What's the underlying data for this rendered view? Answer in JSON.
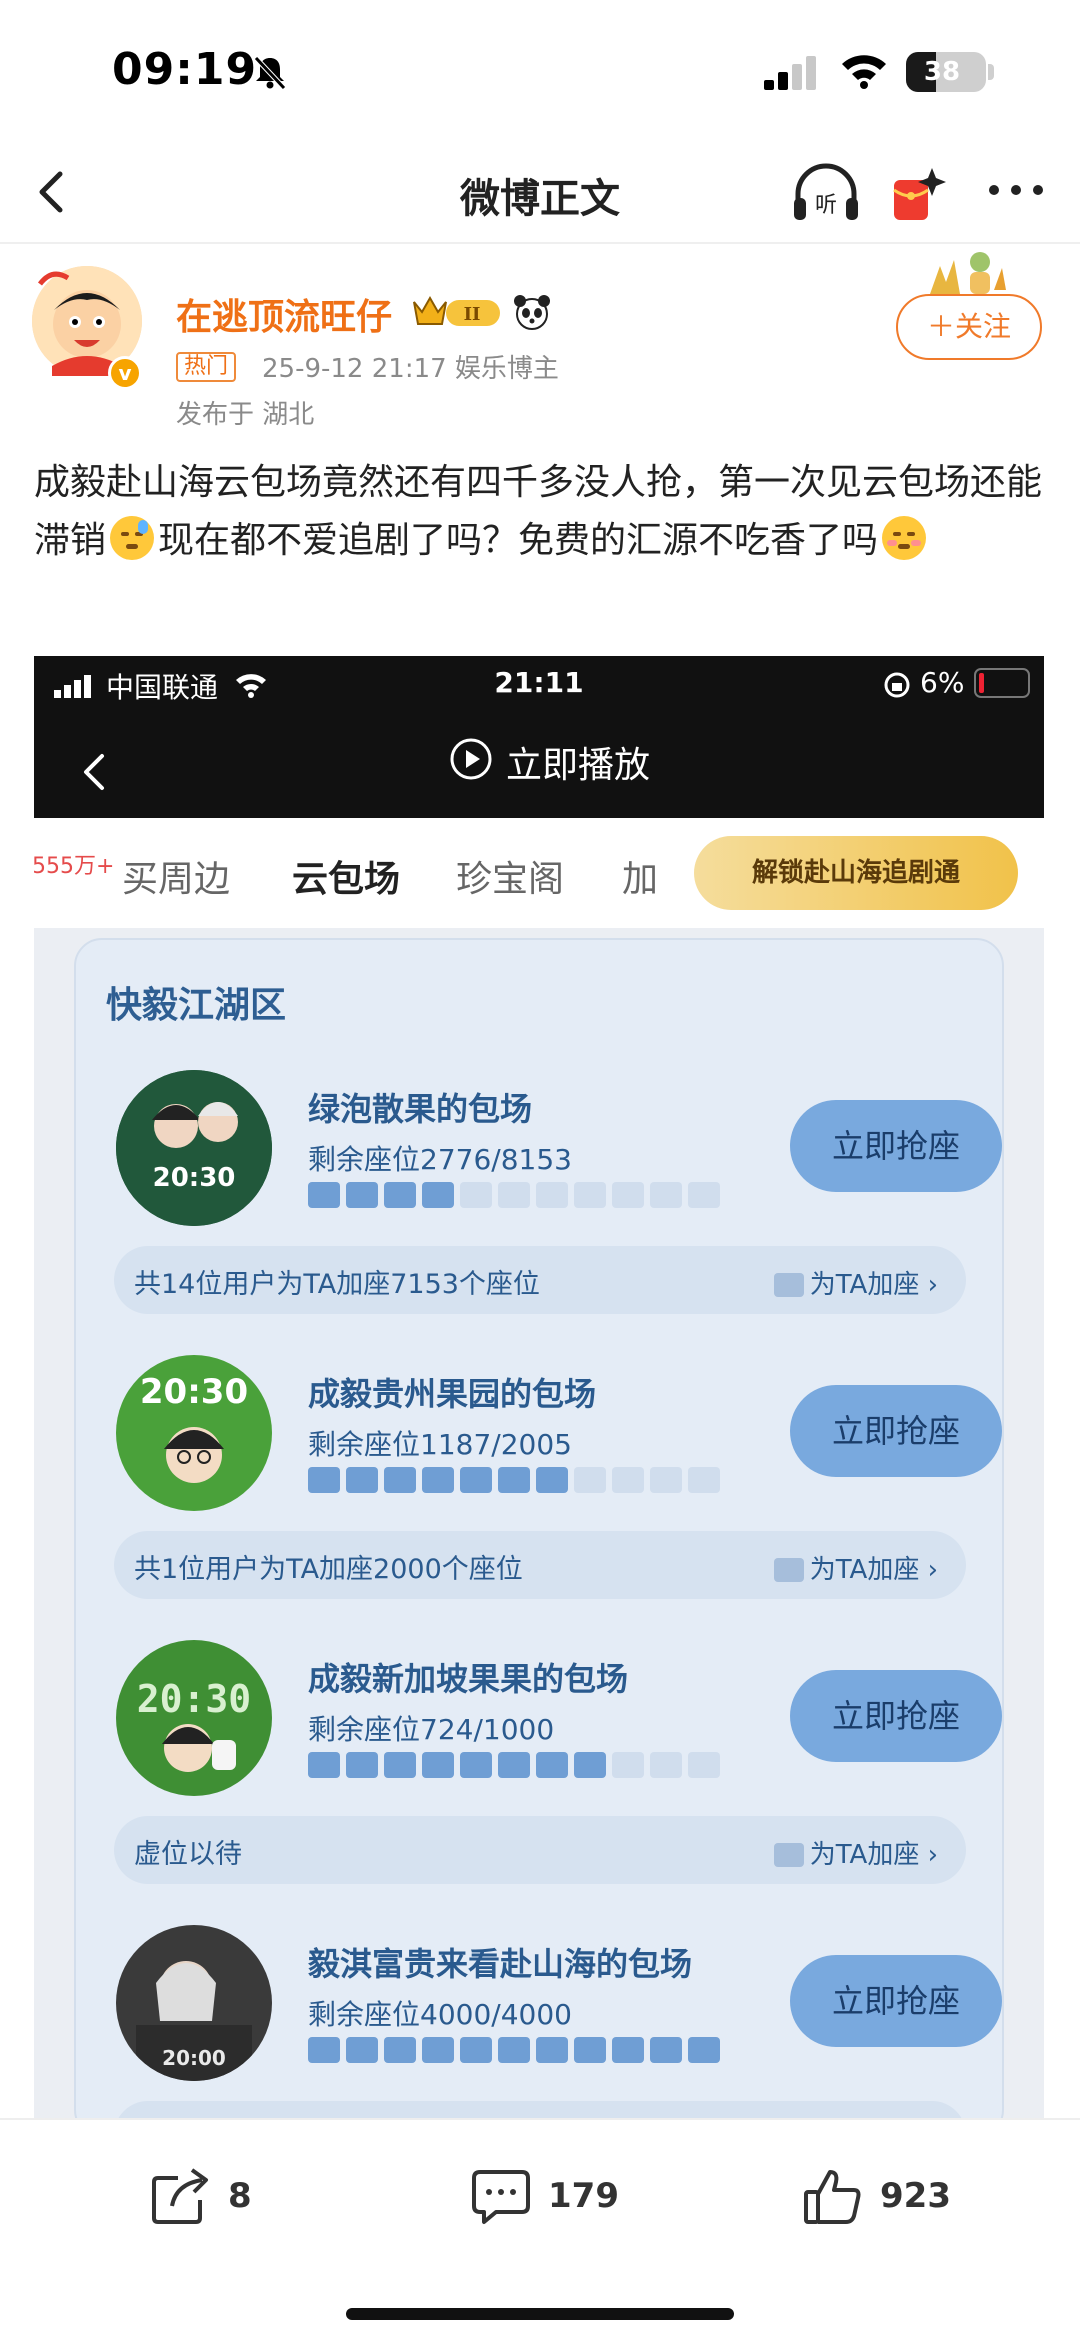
{
  "status_bar": {
    "time": "09:19",
    "battery": "38",
    "battery_level": 0.38
  },
  "nav": {
    "title": "微博正文",
    "listen_icon": "headphones-listen-icon",
    "redpack_icon": "red-packet-icon",
    "more_icon": "more-dots-icon"
  },
  "author": {
    "name": "在逃顶流旺仔",
    "level_badge": "II",
    "hot_tag": "热门",
    "meta": "25-9-12 21:17  娱乐博主",
    "location": "发布于 湖北",
    "follow_label": "＋关注"
  },
  "post": {
    "text_1": "成毅赴山海云包场竟然还有四千多没人抢，第一次见云包场还能滞销",
    "text_2": "现在都不爱追剧了吗？免费的汇源不吃香了吗"
  },
  "screenshot": {
    "carrier": "中国联通",
    "time": "21:11",
    "battery": "6%",
    "play_label": "立即播放",
    "tab_count": "555万+",
    "tabs": [
      "买周边",
      "云包场",
      "珍宝阁",
      "加"
    ],
    "unlock_label": "解锁赴山海追剧通",
    "zone_title": "快毅江湖区",
    "items": [
      {
        "title": "绿泡散果的包场",
        "seats": "剩余座位2776/8153",
        "seats_remaining": 2776,
        "seats_total": 8153,
        "button": "立即抢座",
        "footer": "共14位用户为TA加座7153个座位",
        "footer_link": "为TA加座 ›",
        "cover_text": "20:30"
      },
      {
        "title": "成毅贵州果园的包场",
        "seats": "剩余座位1187/2005",
        "seats_remaining": 1187,
        "seats_total": 2005,
        "button": "立即抢座",
        "footer": "共1位用户为TA加座2000个座位",
        "footer_link": "为TA加座 ›",
        "cover_text": "20:30"
      },
      {
        "title": "成毅新加坡果果的包场",
        "seats": "剩余座位724/1000",
        "seats_remaining": 724,
        "seats_total": 1000,
        "button": "立即抢座",
        "footer": "虚位以待",
        "footer_link": "为TA加座 ›",
        "cover_text": "20:30"
      },
      {
        "title": "毅淇富贵来看赴山海的包场",
        "seats": "剩余座位4000/4000",
        "seats_remaining": 4000,
        "seats_total": 4000,
        "button": "立即抢座",
        "footer": "",
        "footer_link": "",
        "cover_text": "20:00"
      }
    ]
  },
  "bottom_bar": {
    "share_count": "8",
    "comment_count": "179",
    "like_count": "923"
  }
}
